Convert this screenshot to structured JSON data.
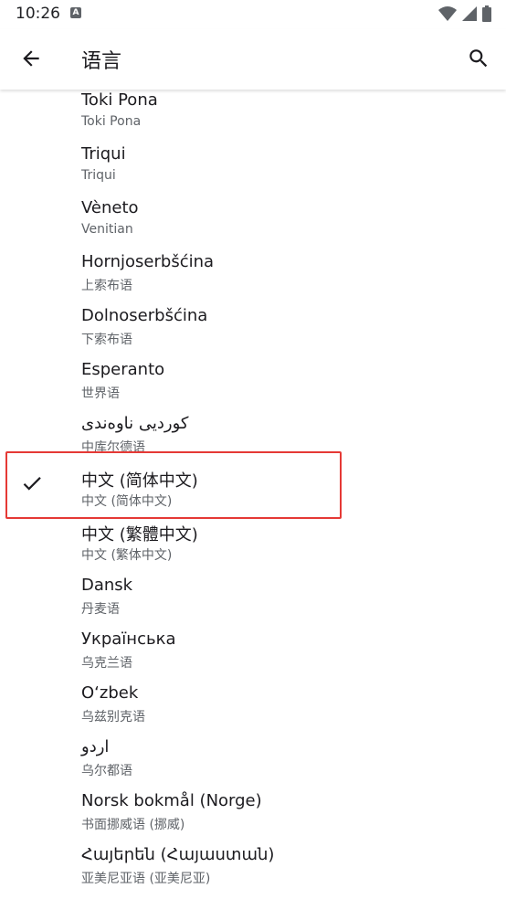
{
  "status_bar": {
    "time": "10:26",
    "notification_icon": "a-box-icon",
    "wifi_icon": "wifi-icon",
    "signal_icon": "signal-icon",
    "battery_icon": "battery-icon"
  },
  "app_bar": {
    "title": "语言",
    "back_icon": "arrow-back-icon",
    "search_icon": "search-icon"
  },
  "languages": [
    {
      "name": "Toki Pona",
      "sub": "Toki Pona",
      "selected": false
    },
    {
      "name": "Triqui",
      "sub": "Triqui",
      "selected": false
    },
    {
      "name": "Vèneto",
      "sub": "Venitian",
      "selected": false
    },
    {
      "name": "Hornjoserbšćina",
      "sub": "上索布语",
      "selected": false
    },
    {
      "name": "Dolnoserbšćina",
      "sub": "下索布语",
      "selected": false
    },
    {
      "name": "Esperanto",
      "sub": "世界语",
      "selected": false
    },
    {
      "name": "کوردیی ناوەندی",
      "sub": "中库尔德语",
      "selected": false
    },
    {
      "name": "中文 (简体中文)",
      "sub": "中文 (简体中文)",
      "selected": true
    },
    {
      "name": "中文 (繁體中文)",
      "sub": "中文 (繁体中文)",
      "selected": false
    },
    {
      "name": "Dansk",
      "sub": "丹麦语",
      "selected": false
    },
    {
      "name": "Українська",
      "sub": "乌克兰语",
      "selected": false
    },
    {
      "name": "O‘zbek",
      "sub": "乌兹别克语",
      "selected": false
    },
    {
      "name": "اردو",
      "sub": "乌尔都语",
      "selected": false
    },
    {
      "name": "Norsk bokmål (Norge)",
      "sub": "书面挪威语 (挪威)",
      "selected": false
    },
    {
      "name": "Հայերեն (Հայաստան)",
      "sub": "亚美尼亚语 (亚美尼亚)",
      "selected": false
    }
  ],
  "colors": {
    "highlight": "#e53935",
    "primary_text": "#1c1b1f",
    "secondary_text": "#5f6368"
  }
}
